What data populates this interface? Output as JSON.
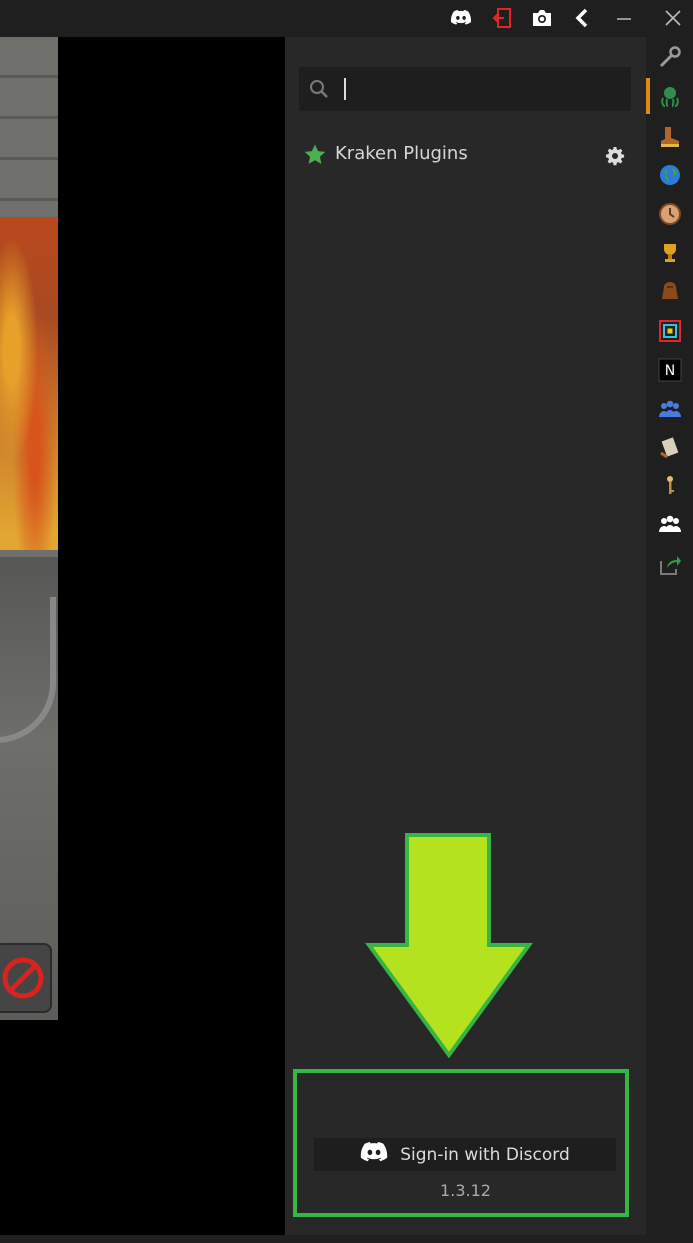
{
  "titlebar": {
    "icons": [
      "discord-icon",
      "logout-icon",
      "camera-icon",
      "back-arrow-icon",
      "minimize-icon",
      "close-icon"
    ]
  },
  "panel": {
    "search": {
      "value": "",
      "placeholder": ""
    },
    "plugins": [
      {
        "label": "Kraken Plugins",
        "icon": "star-icon",
        "action_icon": "gear-icon"
      }
    ],
    "discord_button_label": "Sign-in with Discord",
    "version": "1.3.12"
  },
  "colors": {
    "panel_bg": "#282828",
    "accent_orange": "#e08a16",
    "highlight_green": "#37b543",
    "arrow_green": "#b4e21f",
    "star_green": "#4caf50"
  },
  "nav": {
    "items": [
      "wrench-icon",
      "kraken-icon",
      "boot-icon",
      "globe-icon",
      "clock-icon",
      "trophy-icon",
      "bag-icon",
      "target-square-icon",
      "notes-icon",
      "party-icon",
      "scroll-icon",
      "keyring-icon",
      "friends-icon",
      "share-icon"
    ],
    "active_index": 1
  }
}
